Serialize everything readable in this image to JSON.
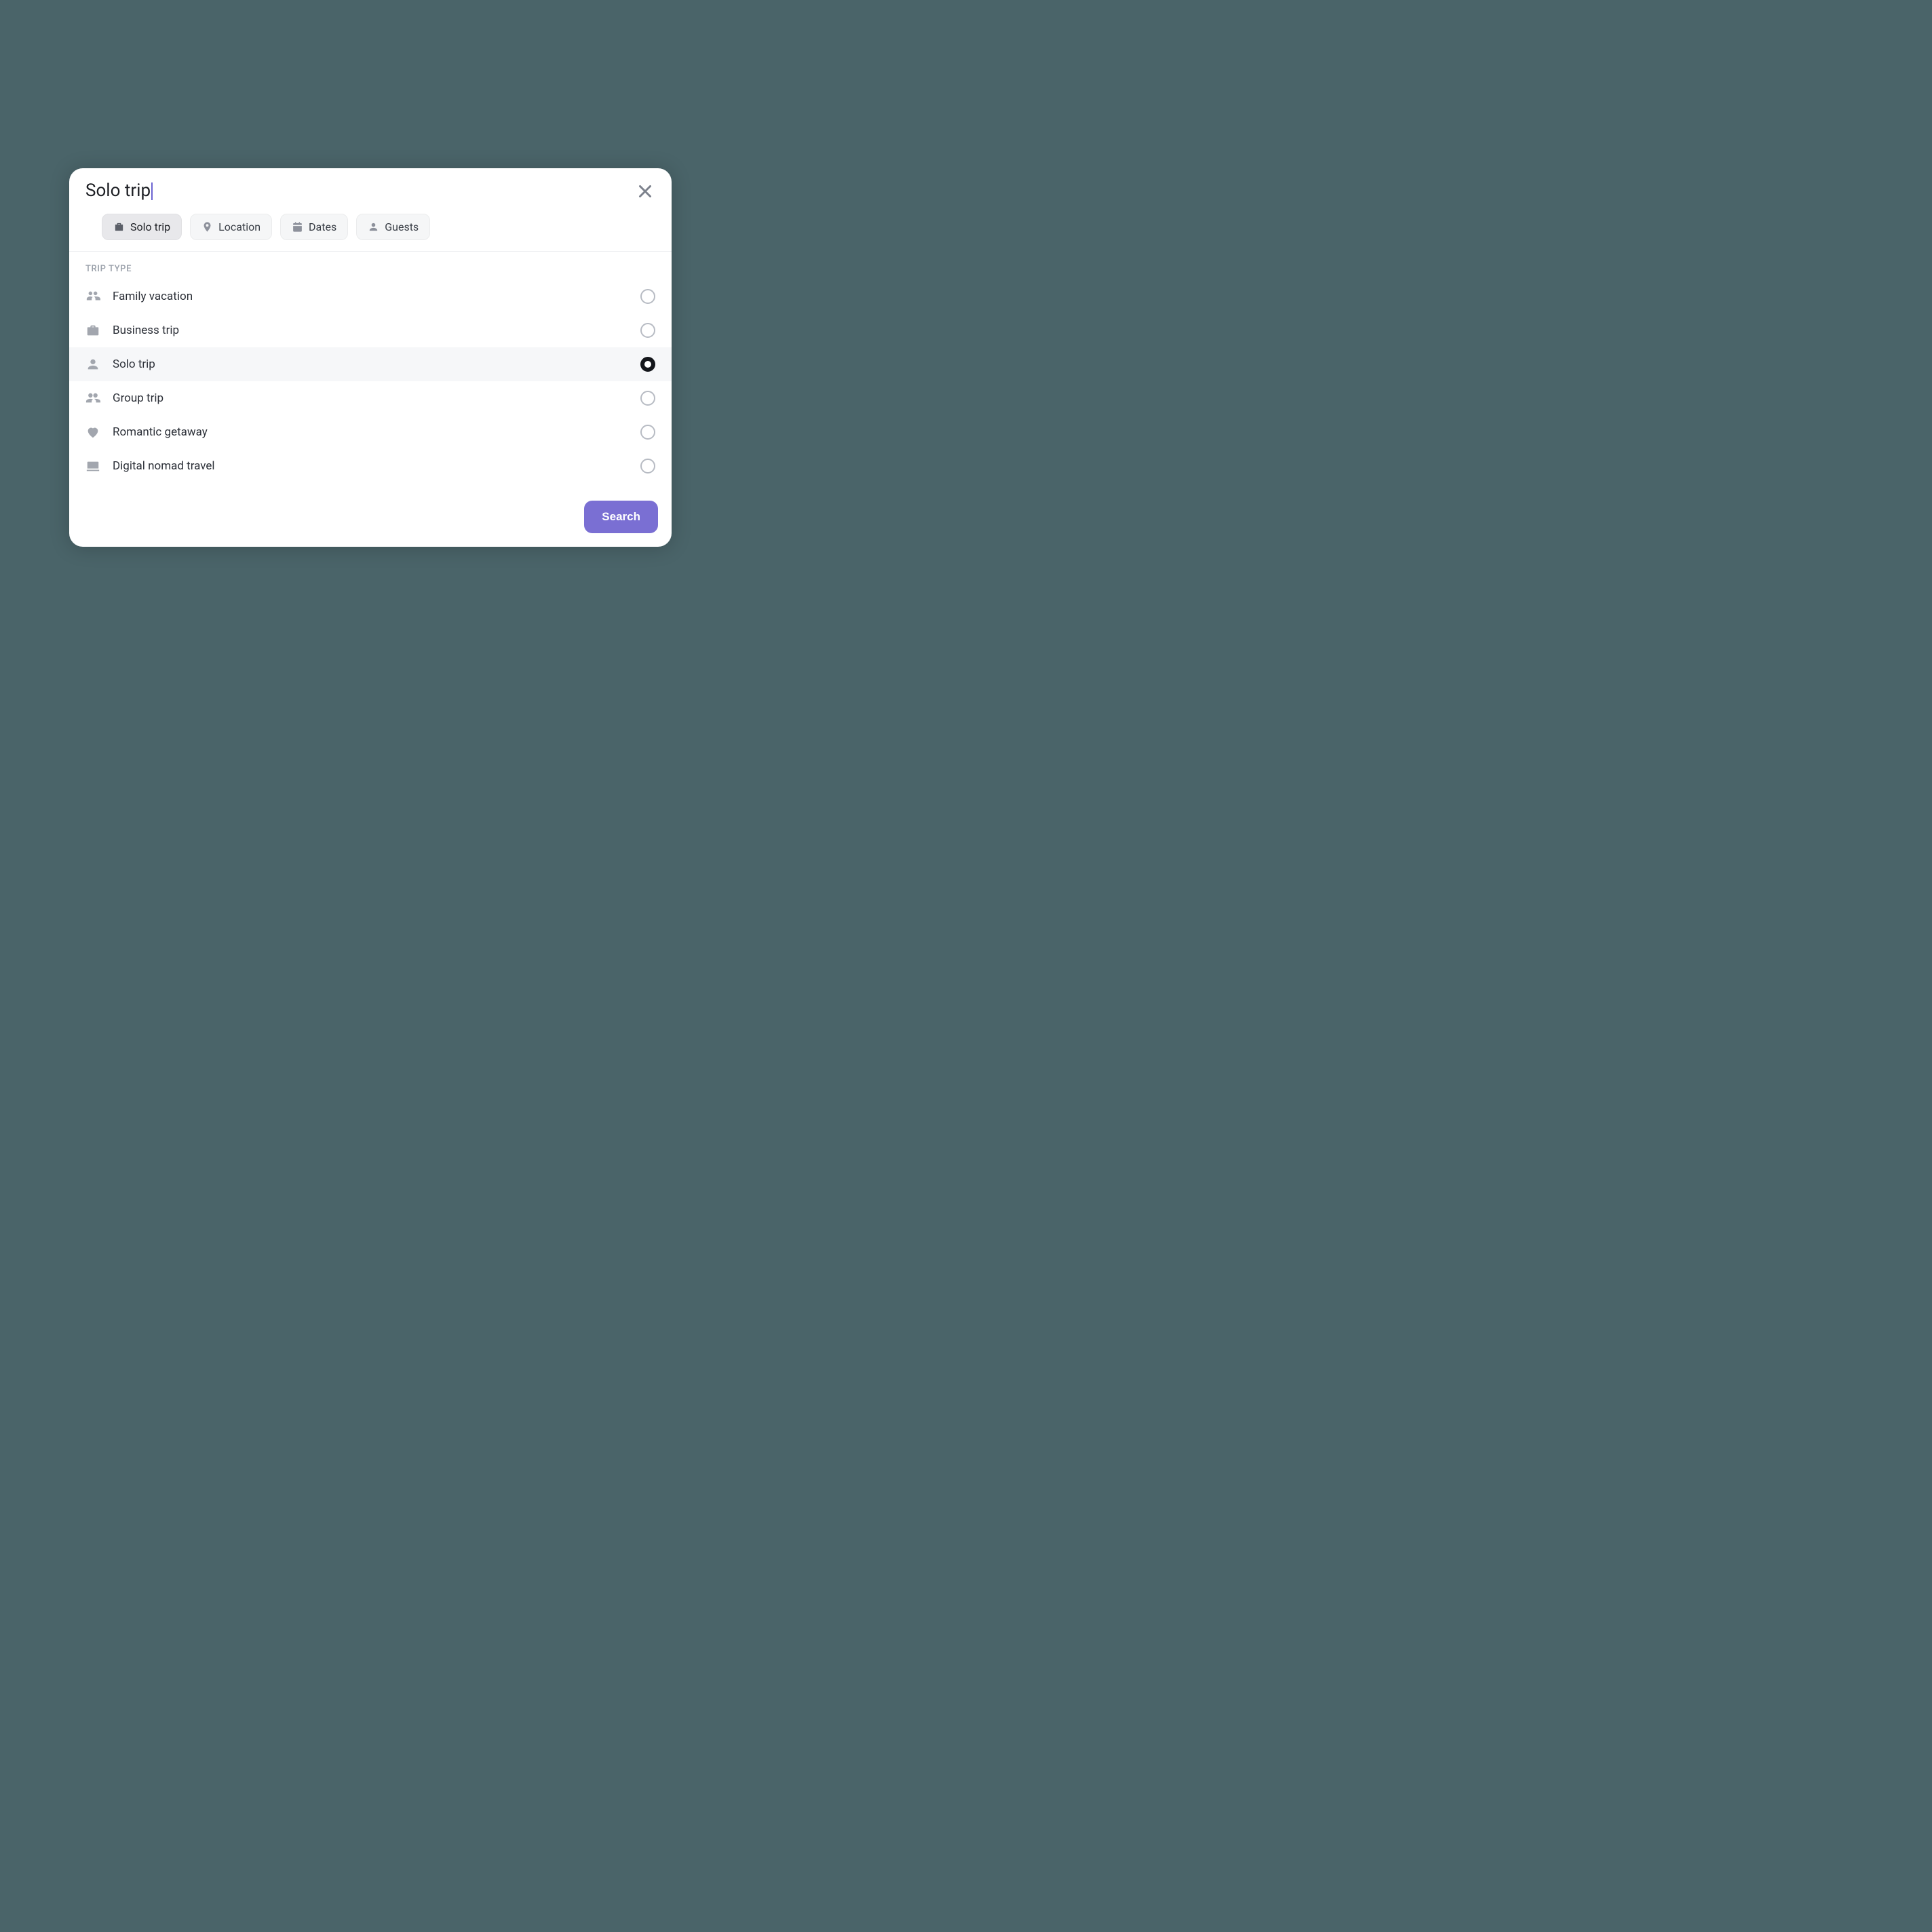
{
  "search": {
    "value": "Solo trip"
  },
  "chips": [
    {
      "label": "Solo trip",
      "icon": "suitcase",
      "active": true
    },
    {
      "label": "Location",
      "icon": "pin",
      "active": false
    },
    {
      "label": "Dates",
      "icon": "calendar",
      "active": false
    },
    {
      "label": "Guests",
      "icon": "person",
      "active": false
    }
  ],
  "section": {
    "title": "TRIP TYPE"
  },
  "options": [
    {
      "label": "Family vacation",
      "icon": "family",
      "selected": false
    },
    {
      "label": "Business trip",
      "icon": "briefcase",
      "selected": false
    },
    {
      "label": "Solo trip",
      "icon": "person",
      "selected": true
    },
    {
      "label": "Group trip",
      "icon": "group",
      "selected": false
    },
    {
      "label": "Romantic getaway",
      "icon": "heart",
      "selected": false
    },
    {
      "label": "Digital nomad travel",
      "icon": "laptop",
      "selected": false
    }
  ],
  "footer": {
    "search_label": "Search"
  }
}
